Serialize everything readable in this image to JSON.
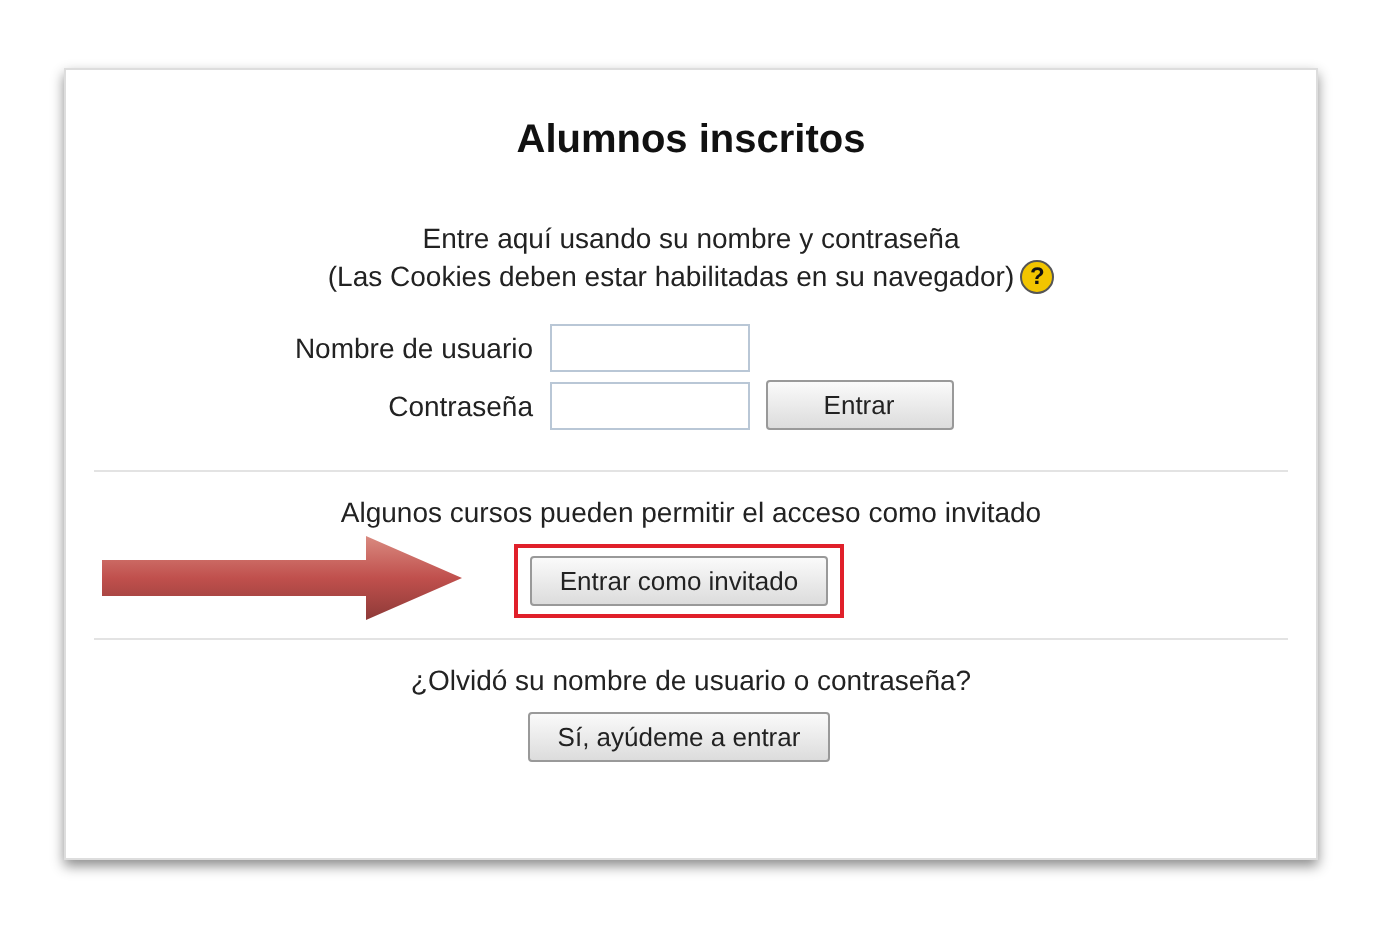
{
  "title": "Alumnos inscritos",
  "intro": [
    "Entre aquí usando su nombre y contraseña",
    "(Las Cookies deben estar habilitadas en su navegador)"
  ],
  "help_icon": "?",
  "fields": [
    {
      "label": "Nombre de usuario"
    },
    {
      "label": "Contraseña"
    }
  ],
  "login_button": "Entrar",
  "guest": {
    "text": "Algunos cursos pueden permitir el acceso como invitado",
    "button": "Entrar como invitado",
    "highlighted": true
  },
  "forgot": {
    "text": "¿Olvidó su nombre de usuario o contraseña?",
    "button": "Sí, ayúdeme a entrar"
  }
}
